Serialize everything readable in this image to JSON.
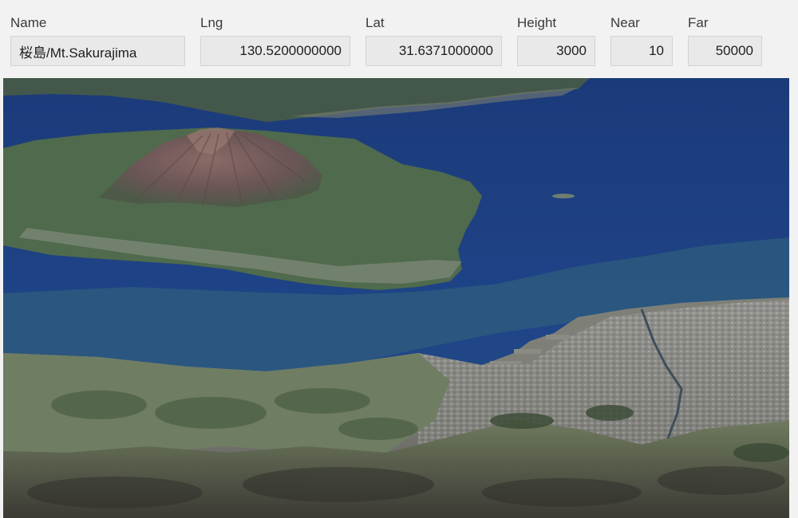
{
  "fields": {
    "name": {
      "label": "Name",
      "value": "桜島/Mt.Sakurajima"
    },
    "lng": {
      "label": "Lng",
      "value": "130.5200000000"
    },
    "lat": {
      "label": "Lat",
      "value": "31.6371000000"
    },
    "height": {
      "label": "Height",
      "value": "3000"
    },
    "near": {
      "label": "Near",
      "value": "10"
    },
    "far": {
      "label": "Far",
      "value": "50000"
    }
  },
  "viewer": {
    "icon": "terrain-3d-map",
    "colors": {
      "sea": "#1f4488",
      "sea_shallow": "#2f5c7c",
      "land_green": "#4f6a4c",
      "volcano": "#6f5a58",
      "city": "#8d8d88"
    }
  }
}
